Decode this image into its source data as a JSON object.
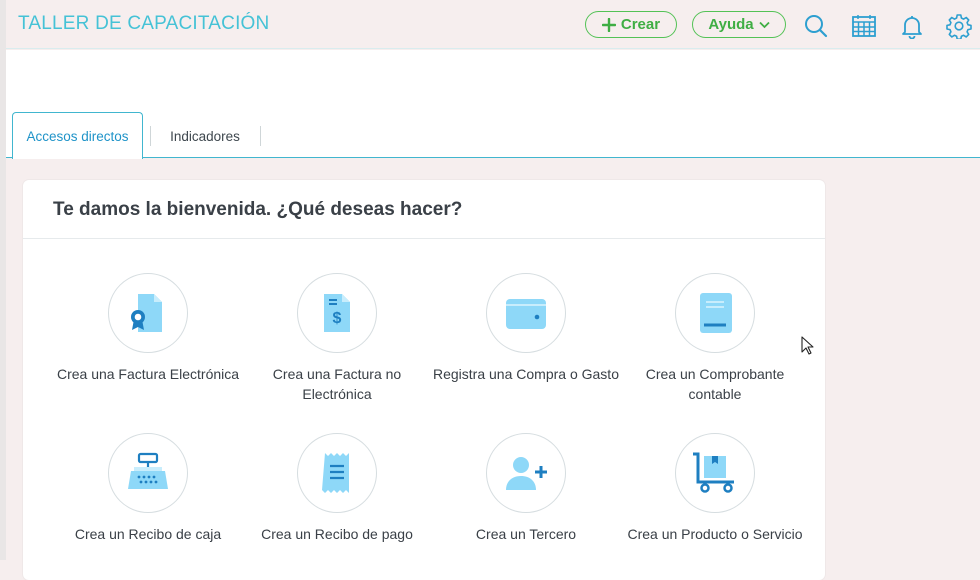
{
  "header": {
    "title": "TALLER DE CAPACITACIÓN",
    "create_label": "Crear",
    "help_label": "Ayuda",
    "icons": [
      "search-icon",
      "calendar-icon",
      "bell-icon",
      "gear-icon"
    ]
  },
  "tabs": [
    {
      "label": "Accesos directos",
      "active": true
    },
    {
      "label": "Indicadores",
      "active": false
    }
  ],
  "welcome": {
    "title": "Te damos la bienvenida. ¿Qué deseas hacer?",
    "actions": [
      {
        "label": "Crea una Factura Electrónica",
        "icon": "electronic-invoice-icon"
      },
      {
        "label": "Crea una Factura no Electrónica",
        "icon": "invoice-dollar-icon"
      },
      {
        "label": "Registra una Compra o Gasto",
        "icon": "wallet-icon"
      },
      {
        "label": "Crea un Comprobante contable",
        "icon": "accounting-book-icon"
      },
      {
        "label": "Crea un Recibo de caja",
        "icon": "cash-register-icon"
      },
      {
        "label": "Crea un Recibo de pago",
        "icon": "payment-receipt-icon"
      },
      {
        "label": "Crea un Tercero",
        "icon": "add-contact-icon"
      },
      {
        "label": "Crea un Producto o Servicio",
        "icon": "product-cart-icon"
      }
    ]
  },
  "colors": {
    "brand_title": "#45c2d6",
    "button_green": "#54c256",
    "accent_blue": "#41b6cf",
    "icon_fill": "#8ed8f8",
    "icon_dark": "#1e7fc1"
  }
}
